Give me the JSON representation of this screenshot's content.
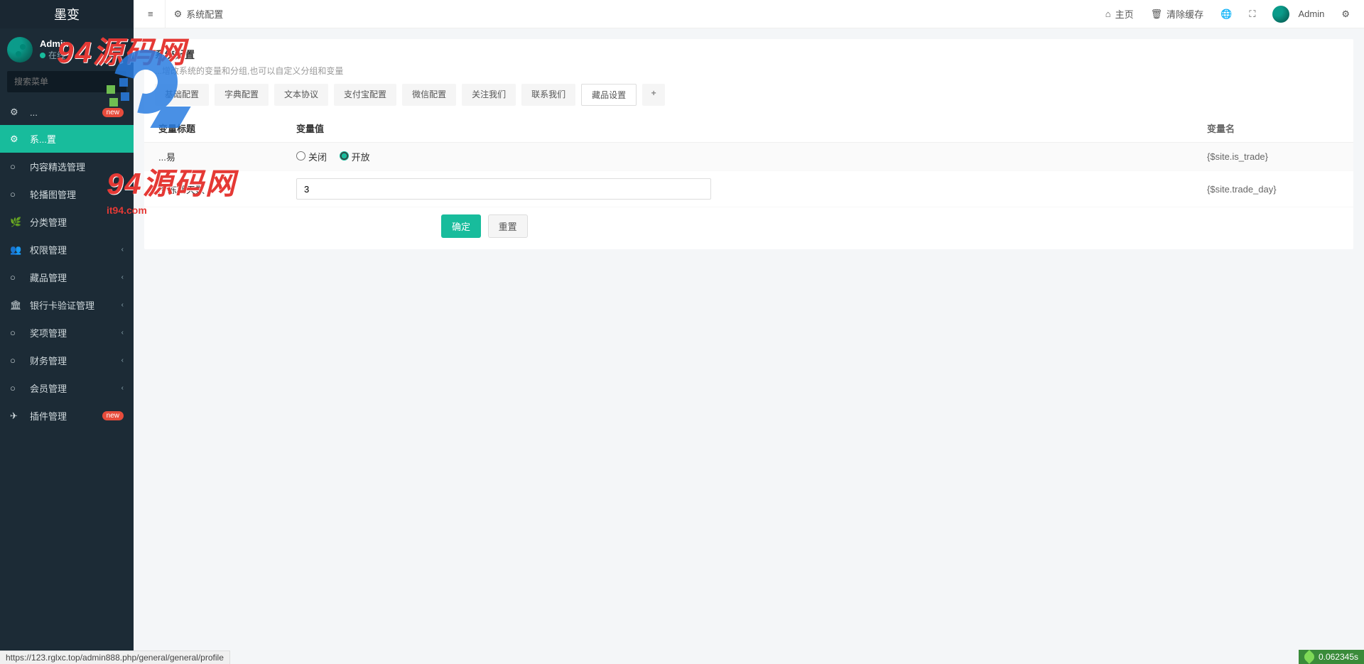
{
  "brand": "墨变",
  "user": {
    "name": "Admin",
    "status": "在线"
  },
  "search": {
    "placeholder": "搜索菜单"
  },
  "menu": [
    {
      "icon": "⚙",
      "label": "...",
      "badge": "new",
      "active": false,
      "caret": false
    },
    {
      "icon": "⚙",
      "label": "系...置",
      "active": true,
      "caret": false
    },
    {
      "icon": "○",
      "label": "内容精选管理",
      "caret": false
    },
    {
      "icon": "○",
      "label": "轮播图管理",
      "caret": false
    },
    {
      "icon": "🌿",
      "label": "分类管理",
      "caret": false
    },
    {
      "icon": "👥",
      "label": "权限管理",
      "caret": true
    },
    {
      "icon": "○",
      "label": "藏品管理",
      "caret": true
    },
    {
      "icon": "🏛",
      "label": "银行卡验证管理",
      "caret": true
    },
    {
      "icon": "○",
      "label": "奖项管理",
      "caret": true
    },
    {
      "icon": "○",
      "label": "财务管理",
      "caret": true
    },
    {
      "icon": "○",
      "label": "会员管理",
      "caret": true
    },
    {
      "icon": "✈",
      "label": "插件管理",
      "badge": "new",
      "caret": false
    }
  ],
  "topbar": {
    "tab_label": "系统配置",
    "right": {
      "home": "主页",
      "clear_cache": "清除缓存",
      "user": "Admin"
    }
  },
  "panel": {
    "title": "系统配置",
    "subtitle": "...增改系统的变量和分组,也可以自定义分组和变量",
    "tabs": [
      "基础配置",
      "字典配置",
      "文本协议",
      "支付宝配置",
      "微信配置",
      "关注我们",
      "联系我们",
      "藏品设置"
    ],
    "active_tab_index": 7,
    "headers": {
      "title": "变量标题",
      "value": "变量值",
      "name": "变量名"
    },
    "rows": [
      {
        "title": "...易",
        "type": "radio",
        "options": {
          "off": "关闭",
          "on": "开放"
        },
        "selected": "on",
        "varname": "{$site.is_trade}"
      },
      {
        "title": "冷冻期天数",
        "type": "number",
        "value": "3",
        "varname": "{$site.trade_day}"
      }
    ],
    "buttons": {
      "ok": "确定",
      "reset": "重置"
    }
  },
  "footer": {
    "status_url": "https://123.rglxc.top/admin888.php/general/general/profile",
    "perf": "0.062345s"
  },
  "watermark": {
    "text": "94源码网",
    "url": "it94.com"
  }
}
